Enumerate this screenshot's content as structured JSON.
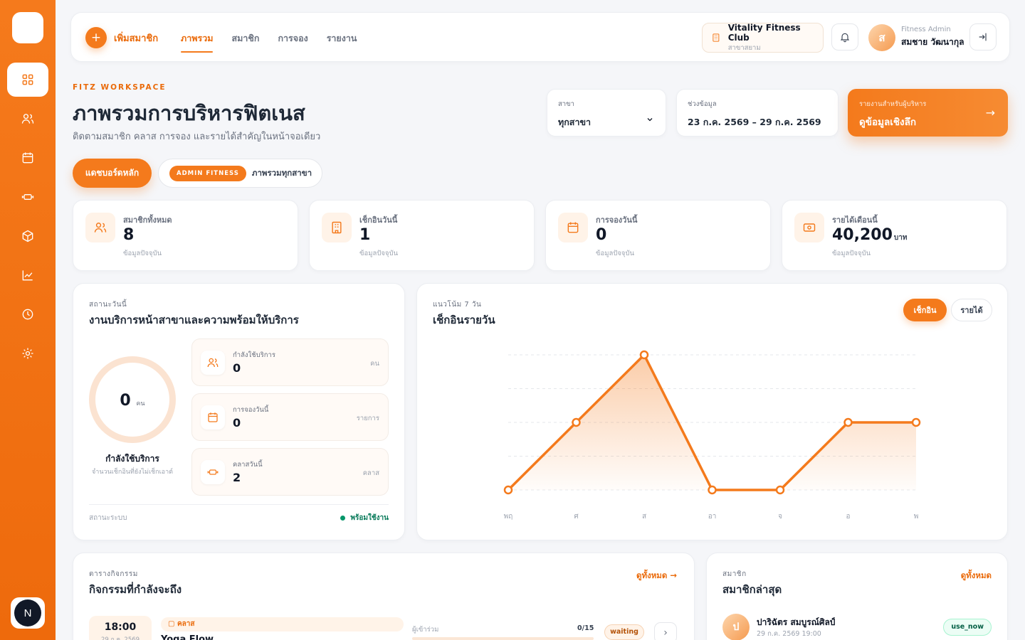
{
  "sidebar": {
    "items": [
      {
        "icon": "grid-icon",
        "active": true
      },
      {
        "icon": "users-icon",
        "active": false
      },
      {
        "icon": "calendar-icon",
        "active": false
      },
      {
        "icon": "dumbbell-icon",
        "active": false
      },
      {
        "icon": "box-icon",
        "active": false
      },
      {
        "icon": "chart-line-icon",
        "active": false
      },
      {
        "icon": "clock-icon",
        "active": false
      },
      {
        "icon": "gear-icon",
        "active": false
      }
    ],
    "badge": "N"
  },
  "topbar": {
    "add_member": "เพิ่มสมาชิก",
    "tabs": [
      {
        "label": "ภาพรวม",
        "active": true
      },
      {
        "label": "สมาชิก",
        "active": false
      },
      {
        "label": "การจอง",
        "active": false
      },
      {
        "label": "รายงาน",
        "active": false
      }
    ],
    "club": {
      "name": "Vitality Fitness Club",
      "branch": "สาขาสยาม"
    },
    "user": {
      "initial": "ส",
      "role": "Fitness Admin",
      "name": "สมชาย วัฒนากุล"
    }
  },
  "header": {
    "eyebrow": "FITZ WORKSPACE",
    "title": "ภาพรวมการบริหารฟิตเนส",
    "subtitle": "ติดตามสมาชิก คลาส การจอง และรายได้สำคัญในหน้าจอเดียว"
  },
  "filters": {
    "branch": {
      "label": "สาขา",
      "value": "ทุกสาขา"
    },
    "range": {
      "label": "ช่วงข้อมูล",
      "value": "23 ก.ค. 2569 – 29 ก.ค. 2569"
    }
  },
  "cta": {
    "label": "รายงานสำหรับผู้บริหาร",
    "value": "ดูข้อมูลเชิงลึก"
  },
  "pills": {
    "main": "แดชบอร์ดหลัก",
    "tag": "ADMIN FITNESS",
    "text": "ภาพรวมทุกสาขา"
  },
  "stats": [
    {
      "icon": "users-icon",
      "label": "สมาชิกทั้งหมด",
      "value": "8",
      "unit": "",
      "note": "ข้อมูลปัจจุบัน"
    },
    {
      "icon": "building-icon",
      "label": "เช็กอินวันนี้",
      "value": "1",
      "unit": "",
      "note": "ข้อมูลปัจจุบัน"
    },
    {
      "icon": "calendar-icon",
      "label": "การจองวันนี้",
      "value": "0",
      "unit": "",
      "note": "ข้อมูลปัจจุบัน"
    },
    {
      "icon": "cash-icon",
      "label": "รายได้เดือนนี้",
      "value": "40,200",
      "unit": "บาท",
      "note": "ข้อมูลปัจจุบัน"
    }
  ],
  "status_card": {
    "eyebrow": "สถานะวันนี้",
    "title": "งานบริการหน้าสาขาและความพร้อมให้บริการ",
    "ring_value": "0",
    "ring_unit": "คน",
    "ring_title": "กำลังใช้บริการ",
    "ring_sub": "จำนวนเช็กอินที่ยังไม่เช็กเอาต์",
    "items": [
      {
        "icon": "users-icon",
        "label": "กำลังใช้บริการ",
        "value": "0",
        "unit": "คน"
      },
      {
        "icon": "calendar-icon",
        "label": "การจองวันนี้",
        "value": "0",
        "unit": "รายการ"
      },
      {
        "icon": "dumbbell-icon",
        "label": "คลาสวันนี้",
        "value": "2",
        "unit": "คลาส"
      }
    ],
    "system_label": "สถานะระบบ",
    "system_status": "พร้อมใช้งาน"
  },
  "trend_card": {
    "eyebrow": "แนวโน้ม 7 วัน",
    "title": "เช็กอินรายวัน",
    "toggle_on": "เช็กอิน",
    "toggle_off": "รายได้"
  },
  "chart_data": {
    "type": "area",
    "categories": [
      "พฤ",
      "ศ",
      "ส",
      "อา",
      "จ",
      "อ",
      "พ"
    ],
    "series": [
      {
        "values": [
          0,
          1,
          2,
          0,
          0,
          1,
          1
        ]
      }
    ],
    "ylim": [
      0,
      2
    ],
    "grid": true,
    "color": "#f47a1c"
  },
  "schedule": {
    "eyebrow": "ตารางกิจกรรม",
    "title": "กิจกรรมที่กำลังจะถึง",
    "view_all": "ดูทั้งหมด",
    "event": {
      "time": "18:00",
      "date": "29 ก.ค. 2569",
      "type": "คลาส",
      "name": "Yoga Flow",
      "participants_label": "ผู้เข้าร่วม",
      "participants": "0/15",
      "fill": 0,
      "status": "waiting"
    }
  },
  "members": {
    "eyebrow": "สมาชิก",
    "title": "สมาชิกล่าสุด",
    "view_all": "ดูทั้งหมด",
    "item": {
      "initial": "ป",
      "name": "ปาริฉัตร สมบูรณ์ศิลป์",
      "date": "29 ก.ค. 2569 19:00",
      "badge": "use_now"
    }
  },
  "colors": {
    "accent": "#f47a1c",
    "success": "#059669"
  }
}
